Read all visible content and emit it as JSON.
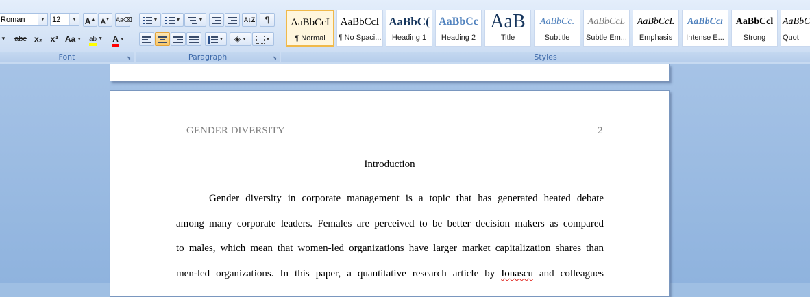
{
  "ribbon": {
    "font": {
      "label": "Font",
      "font_name": "Roman",
      "font_size": "12",
      "grow_label": "A",
      "shrink_label": "A",
      "strike_label": "abc",
      "subscript_label": "x₂",
      "superscript_label": "x²",
      "case_label": "Aa",
      "highlight_label": "ab",
      "font_color_label": "A",
      "highlight_color": "#ffff00",
      "font_color": "#ff0000"
    },
    "paragraph": {
      "label": "Paragraph",
      "sort_label": "A↓Z",
      "show_marks_label": "¶",
      "alignment_active": "center"
    },
    "styles": {
      "label": "Styles",
      "items": [
        {
          "sample": "AaBbCcI",
          "name": "¶ Normal"
        },
        {
          "sample": "AaBbCcI",
          "name": "¶ No Spaci..."
        },
        {
          "sample": "AaBbC(",
          "name": "Heading 1"
        },
        {
          "sample": "AaBbCc",
          "name": "Heading 2"
        },
        {
          "sample": "AaB",
          "name": "Title"
        },
        {
          "sample": "AaBbCc.",
          "name": "Subtitle"
        },
        {
          "sample": "AaBbCcL",
          "name": "Subtle Em..."
        },
        {
          "sample": "AaBbCcL",
          "name": "Emphasis"
        },
        {
          "sample": "AaBbCcı",
          "name": "Intense E..."
        },
        {
          "sample": "AaBbCcl",
          "name": "Strong"
        },
        {
          "sample": "AaBbC",
          "name": "Quot"
        }
      ]
    }
  },
  "document": {
    "running_head": "GENDER DIVERSITY",
    "page_number": "2",
    "section_title": "Introduction",
    "lines": [
      "Gender diversity in corporate management is a topic that has generated heated debate",
      "among many corporate leaders. Females are perceived to be better decision makers as compared",
      "to males, which mean that women-led organizations have larger market capitalization shares than"
    ],
    "line4_before": "men-led organizations.  In this paper, a quantitative research article by ",
    "line4_misspelled": "Ionascu",
    "line4_after": " and colleagues"
  }
}
